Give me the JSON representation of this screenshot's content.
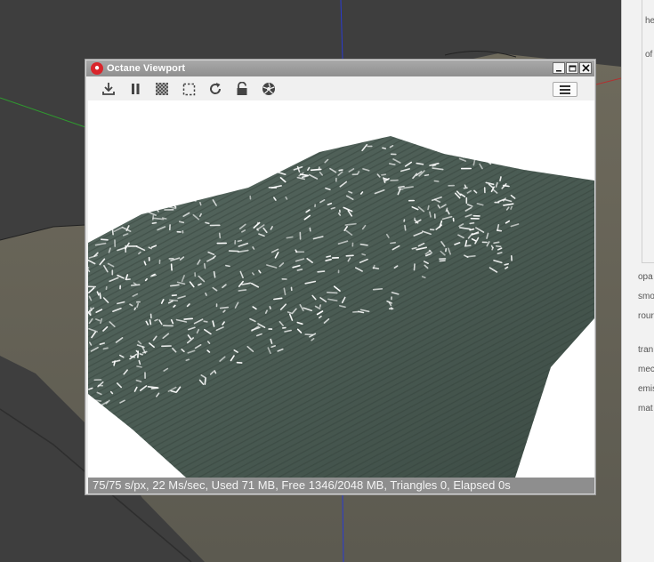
{
  "window": {
    "title": "Octane Viewport",
    "icon": "octane-logo-icon"
  },
  "window_controls": [
    {
      "name": "minimize-button",
      "icon": "minimize-icon"
    },
    {
      "name": "maximize-button",
      "icon": "maximize-icon"
    },
    {
      "name": "close-button",
      "icon": "close-icon"
    }
  ],
  "toolbar": {
    "tools": [
      {
        "name": "save-render-button",
        "icon": "download-icon"
      },
      {
        "name": "pause-render-button",
        "icon": "pause-icon"
      },
      {
        "name": "checker-toggle-button",
        "icon": "checkerboard-icon"
      },
      {
        "name": "region-render-button",
        "icon": "dashed-square-icon"
      },
      {
        "name": "restart-render-button",
        "icon": "refresh-icon"
      },
      {
        "name": "lock-button",
        "icon": "lock-icon"
      },
      {
        "name": "settings-button",
        "icon": "aperture-icon"
      }
    ],
    "menu_icon": "hamburger-menu-icon"
  },
  "status": {
    "text": "75/75 s/px, 22 Ms/sec, Used 71 MB, Free 1346/2048 MB, Triangles 0, Elapsed 0s"
  },
  "side_panel": {
    "labels": [
      "he",
      "of",
      "opa",
      "smo",
      "rour",
      "tran",
      "mec",
      "emis",
      "mat"
    ]
  },
  "colors": {
    "scene_background": "#3d3d3d",
    "terrain": "#6f6a5a",
    "titlebar": "#9c9c9c",
    "status_bar": "#8e8e8e",
    "render_background": "#ffffff",
    "grass": "#4a5c55",
    "app_icon": "#d9262c"
  }
}
